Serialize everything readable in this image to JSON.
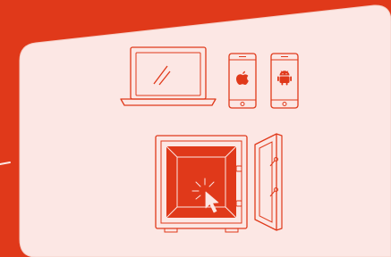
{
  "scene": {
    "colors": {
      "background": "#e0391a",
      "card": "#fce7e4",
      "line": "#e0391a",
      "safe_interior": "#e0391a",
      "card_border": "#f5d0c8"
    },
    "icons": {
      "laptop": "laptop-icon",
      "iphone": "iphone-icon",
      "android_phone": "android-phone-icon",
      "safe": "safe-icon",
      "cursor": "mouse-pointer-icon"
    }
  }
}
